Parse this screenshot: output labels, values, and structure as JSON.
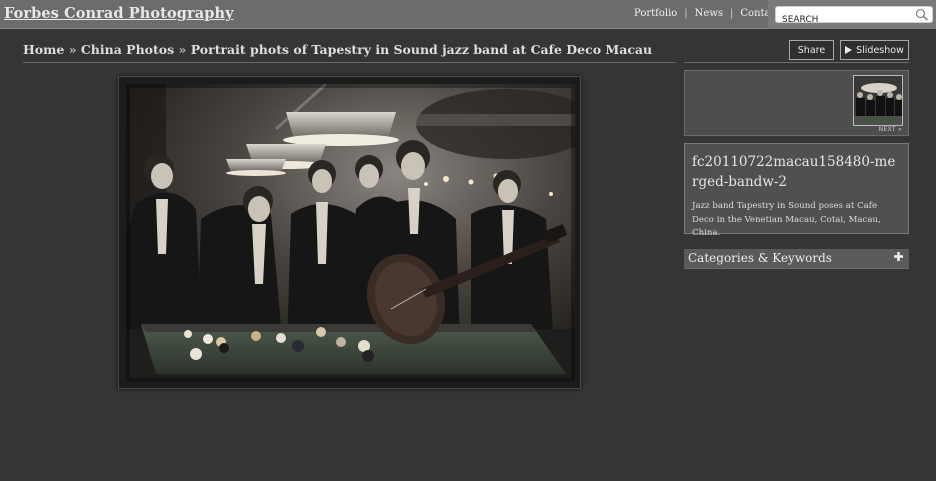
{
  "site": {
    "title": "Forbes Conrad Photography"
  },
  "nav": {
    "items": [
      "Portfolio",
      "News",
      "Contact"
    ],
    "separator": "|"
  },
  "search": {
    "value": "SEARCH",
    "icon": "magnifier-icon"
  },
  "breadcrumb": {
    "home": "Home",
    "category": "China Photos",
    "current": "Portrait phots of Tapestry in Sound jazz band at Cafe Deco Macau",
    "separator": "»"
  },
  "actions": {
    "share": "Share",
    "slideshow": "Slideshow"
  },
  "filmstrip": {
    "next": "NEXT »"
  },
  "photo_info": {
    "title": "fc20110722macau158480-merged-bandw-2",
    "description": "Jazz band Tapestry in Sound poses at Cafe Deco in the Venetian Macau, Cotai, Macau, China."
  },
  "categories": {
    "label": "Categories & Keywords"
  },
  "colors": {
    "background": "#353535",
    "topbar": "#6c6c6c",
    "panel": "#505050"
  }
}
